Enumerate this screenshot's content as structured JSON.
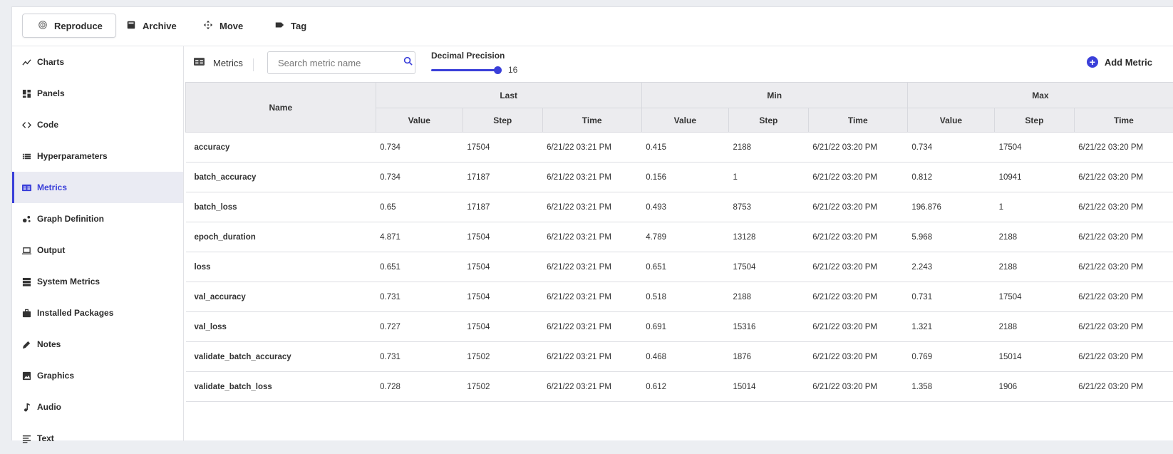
{
  "toolbar": {
    "reproduce_label": "Reproduce",
    "archive_label": "Archive",
    "move_label": "Move",
    "tag_label": "Tag"
  },
  "sidebar": {
    "items": [
      {
        "label": "Charts",
        "icon": "line-chart-icon",
        "active": false
      },
      {
        "label": "Panels",
        "icon": "dashboard-icon",
        "active": false
      },
      {
        "label": "Code",
        "icon": "code-icon",
        "active": false
      },
      {
        "label": "Hyperparameters",
        "icon": "list-icon",
        "active": false
      },
      {
        "label": "Metrics",
        "icon": "metrics-icon",
        "active": true
      },
      {
        "label": "Graph Definition",
        "icon": "graph-icon",
        "active": false
      },
      {
        "label": "Output",
        "icon": "laptop-icon",
        "active": false
      },
      {
        "label": "System Metrics",
        "icon": "server-icon",
        "active": false
      },
      {
        "label": "Installed Packages",
        "icon": "briefcase-icon",
        "active": false
      },
      {
        "label": "Notes",
        "icon": "pencil-icon",
        "active": false
      },
      {
        "label": "Graphics",
        "icon": "image-icon",
        "active": false
      },
      {
        "label": "Audio",
        "icon": "music-note-icon",
        "active": false
      },
      {
        "label": "Text",
        "icon": "text-icon",
        "active": false
      }
    ]
  },
  "main": {
    "title": "Metrics",
    "search_placeholder": "Search metric name",
    "precision_label": "Decimal Precision",
    "precision_value": "16",
    "precision_fraction": 1.0,
    "add_metric_label": "Add Metric",
    "accent_color": "#3a3fd9"
  },
  "table": {
    "name_header": "Name",
    "groups": [
      "Last",
      "Min",
      "Max"
    ],
    "sub_headers": [
      "Value",
      "Step",
      "Time"
    ],
    "rows": [
      {
        "name": "accuracy",
        "cells": [
          "0.734",
          "17504",
          "6/21/22 03:21 PM",
          "0.415",
          "2188",
          "6/21/22 03:20 PM",
          "0.734",
          "17504",
          "6/21/22 03:20 PM"
        ]
      },
      {
        "name": "batch_accuracy",
        "cells": [
          "0.734",
          "17187",
          "6/21/22 03:21 PM",
          "0.156",
          "1",
          "6/21/22 03:20 PM",
          "0.812",
          "10941",
          "6/21/22 03:20 PM"
        ]
      },
      {
        "name": "batch_loss",
        "cells": [
          "0.65",
          "17187",
          "6/21/22 03:21 PM",
          "0.493",
          "8753",
          "6/21/22 03:20 PM",
          "196.876",
          "1",
          "6/21/22 03:20 PM"
        ]
      },
      {
        "name": "epoch_duration",
        "cells": [
          "4.871",
          "17504",
          "6/21/22 03:21 PM",
          "4.789",
          "13128",
          "6/21/22 03:20 PM",
          "5.968",
          "2188",
          "6/21/22 03:20 PM"
        ]
      },
      {
        "name": "loss",
        "cells": [
          "0.651",
          "17504",
          "6/21/22 03:21 PM",
          "0.651",
          "17504",
          "6/21/22 03:20 PM",
          "2.243",
          "2188",
          "6/21/22 03:20 PM"
        ]
      },
      {
        "name": "val_accuracy",
        "cells": [
          "0.731",
          "17504",
          "6/21/22 03:21 PM",
          "0.518",
          "2188",
          "6/21/22 03:20 PM",
          "0.731",
          "17504",
          "6/21/22 03:20 PM"
        ]
      },
      {
        "name": "val_loss",
        "cells": [
          "0.727",
          "17504",
          "6/21/22 03:21 PM",
          "0.691",
          "15316",
          "6/21/22 03:20 PM",
          "1.321",
          "2188",
          "6/21/22 03:20 PM"
        ]
      },
      {
        "name": "validate_batch_accuracy",
        "cells": [
          "0.731",
          "17502",
          "6/21/22 03:21 PM",
          "0.468",
          "1876",
          "6/21/22 03:20 PM",
          "0.769",
          "15014",
          "6/21/22 03:20 PM"
        ]
      },
      {
        "name": "validate_batch_loss",
        "cells": [
          "0.728",
          "17502",
          "6/21/22 03:21 PM",
          "0.612",
          "15014",
          "6/21/22 03:20 PM",
          "1.358",
          "1906",
          "6/21/22 03:20 PM"
        ]
      }
    ]
  }
}
